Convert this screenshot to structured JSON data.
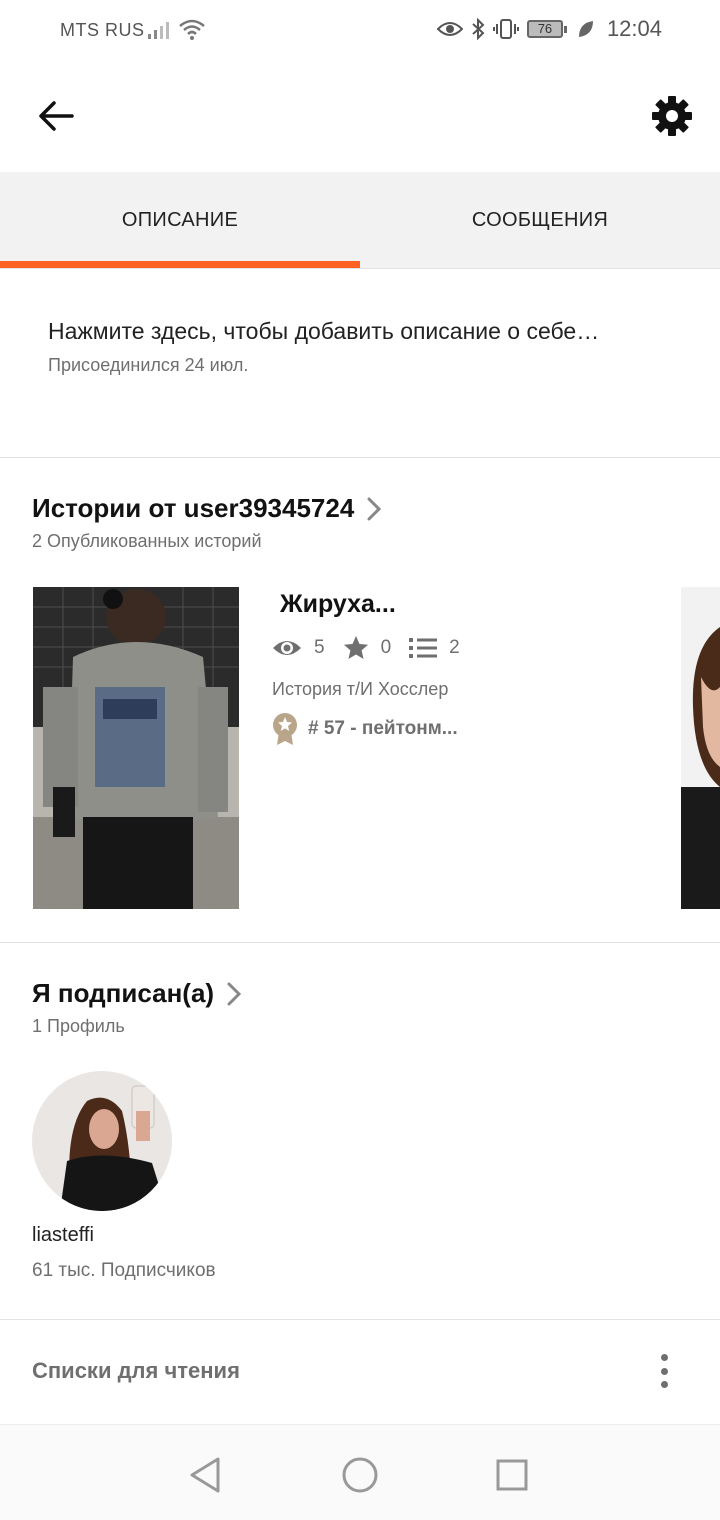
{
  "status_bar": {
    "carrier": "MTS RUS",
    "battery": "76",
    "time": "12:04",
    "icons": [
      "signal-icon",
      "wifi-icon",
      "eye-icon",
      "bluetooth-icon",
      "vibrate-icon",
      "battery-icon",
      "leaf-icon"
    ]
  },
  "top_bar": {
    "icons": [
      "back-arrow-icon",
      "gear-icon"
    ]
  },
  "tabs": [
    {
      "label": "ОПИСАНИЕ",
      "active": true
    },
    {
      "label": "СООБЩЕНИЯ",
      "active": false
    }
  ],
  "accent_color": "#ff6122",
  "about": {
    "description": "Нажмите здесь, чтобы добавить описание о себе…",
    "joined": "Присоединился 24 июл."
  },
  "stories": {
    "title": "Истории от user39345724",
    "subtitle": "2 Опубликованных историй",
    "items": [
      {
        "title": "Жируха...",
        "views": "5",
        "votes": "0",
        "parts": "2",
        "author_line": "История т/И Хосслер",
        "rank": "# 57 - пейтонм..."
      }
    ]
  },
  "following": {
    "title": "Я подписан(а)",
    "subtitle": "1 Профиль",
    "profiles": [
      {
        "username": "liasteffi",
        "followers": "61 тыс. Подписчиков"
      }
    ]
  },
  "reading_lists": {
    "label": "Списки для чтения"
  },
  "nav_bar": {
    "icons": [
      "nav-back-icon",
      "nav-home-icon",
      "nav-recents-icon"
    ]
  }
}
